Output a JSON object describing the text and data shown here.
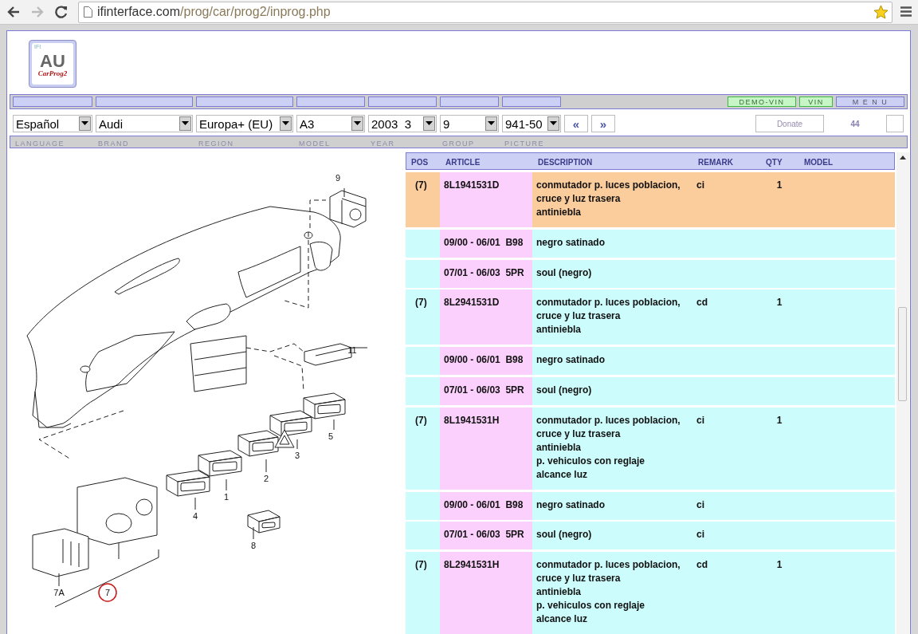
{
  "browser": {
    "url_host": "ifinterface.com",
    "url_path": "/prog/car/prog2/inprog.php"
  },
  "logo": {
    "small": "IFI",
    "main": "AU",
    "script": "CarProg2"
  },
  "nav_buttons": [
    {
      "label": "DEMO-VIN",
      "kind": "vin"
    },
    {
      "label": "VIN",
      "kind": "vin"
    },
    {
      "label": "M E N U",
      "kind": "menu"
    }
  ],
  "selectors": [
    {
      "value": "Español",
      "label": "LANGUAGE"
    },
    {
      "value": "Audi",
      "label": "BRAND"
    },
    {
      "value": "Europa+ (EU)",
      "label": "REGION"
    },
    {
      "value": "A3",
      "label": "MODEL"
    },
    {
      "value": "2003  3",
      "label": "YEAR"
    },
    {
      "value": "9",
      "label": "GROUP"
    },
    {
      "value": "941-50",
      "label": "PICTURE"
    }
  ],
  "pager": [
    "«",
    "»"
  ],
  "donate": "Donate",
  "count": "44",
  "diagram": {
    "callouts": [
      {
        "label": "9",
        "highlighted": false
      },
      {
        "label": "11",
        "highlighted": false
      },
      {
        "label": "5",
        "highlighted": false
      },
      {
        "label": "3",
        "highlighted": false
      },
      {
        "label": "2",
        "highlighted": false
      },
      {
        "label": "1",
        "highlighted": false
      },
      {
        "label": "4",
        "highlighted": false
      },
      {
        "label": "8",
        "highlighted": false
      },
      {
        "label": "7A",
        "highlighted": false
      },
      {
        "label": "7",
        "highlighted": true
      }
    ]
  },
  "table": {
    "columns": [
      "POS",
      "ARTICLE",
      "DESCRIPTION",
      "REMARK",
      "QTY",
      "MODEL"
    ],
    "rows": [
      {
        "kind": "part",
        "selected": true,
        "pos": "(7)",
        "article": "8L1941531D",
        "description": [
          "conmutador p. luces poblacion,",
          "cruce y luz trasera",
          "antiniebla"
        ],
        "remark": "ci",
        "qty": "1"
      },
      {
        "kind": "variant",
        "selected": false,
        "article": "09/00 - 06/01  B98",
        "description": [
          "negro satinado"
        ]
      },
      {
        "kind": "variant",
        "selected": false,
        "article": "07/01 - 06/03  5PR",
        "description": [
          "soul (negro)"
        ]
      },
      {
        "kind": "part",
        "selected": false,
        "pos": "(7)",
        "article": "8L2941531D",
        "description": [
          "conmutador p. luces poblacion,",
          "cruce y luz trasera",
          "antiniebla"
        ],
        "remark": "cd",
        "qty": "1"
      },
      {
        "kind": "variant",
        "selected": false,
        "article": "09/00 - 06/01  B98",
        "description": [
          "negro satinado"
        ]
      },
      {
        "kind": "variant",
        "selected": false,
        "article": "07/01 - 06/03  5PR",
        "description": [
          "soul (negro)"
        ]
      },
      {
        "kind": "part",
        "selected": false,
        "pos": "(7)",
        "article": "8L1941531H",
        "description": [
          "conmutador p. luces poblacion,",
          "cruce y luz trasera",
          "antiniebla",
          "p. vehiculos con reglaje",
          "alcance luz"
        ],
        "remark": "ci",
        "qty": "1"
      },
      {
        "kind": "variant",
        "selected": false,
        "article": "09/00 - 06/01  B98",
        "description": [
          "negro satinado"
        ],
        "remark": "ci"
      },
      {
        "kind": "variant",
        "selected": false,
        "article": "07/01 - 06/03  5PR",
        "description": [
          "soul (negro)"
        ],
        "remark": "ci"
      },
      {
        "kind": "part",
        "selected": false,
        "pos": "(7)",
        "article": "8L2941531H",
        "description": [
          "conmutador p. luces poblacion,",
          "cruce y luz trasera",
          "antiniebla",
          "p. vehiculos con reglaje",
          "alcance luz"
        ],
        "remark": "cd",
        "qty": "1"
      }
    ]
  }
}
